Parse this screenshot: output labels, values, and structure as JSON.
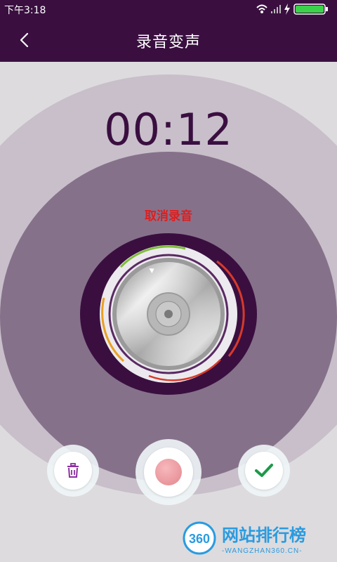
{
  "status_bar": {
    "time": "下午3:18",
    "icons": [
      "wifi-icon",
      "signal-icon",
      "charging-icon",
      "battery-icon"
    ]
  },
  "header": {
    "title": "录音变声",
    "back_icon": "chevron-left-icon"
  },
  "recorder": {
    "timer": "00:12",
    "cancel_label": "取消录音",
    "dial_icon": "metal-knob-icon"
  },
  "controls": {
    "delete_icon": "trash-icon",
    "record_icon": "record-dot-icon",
    "confirm_icon": "checkmark-icon"
  },
  "watermark": {
    "logo_text": "360",
    "text": "网站排行榜",
    "subtext": "-WANGZHAN360.CN-"
  },
  "colors": {
    "header_bg": "#3a0f40",
    "outer_ring": "#c8bfca",
    "inner_ring": "#86718a",
    "cancel_text": "#e01d1d",
    "confirm_check": "#1a9a48",
    "delete_icon": "#8a2fa0"
  }
}
